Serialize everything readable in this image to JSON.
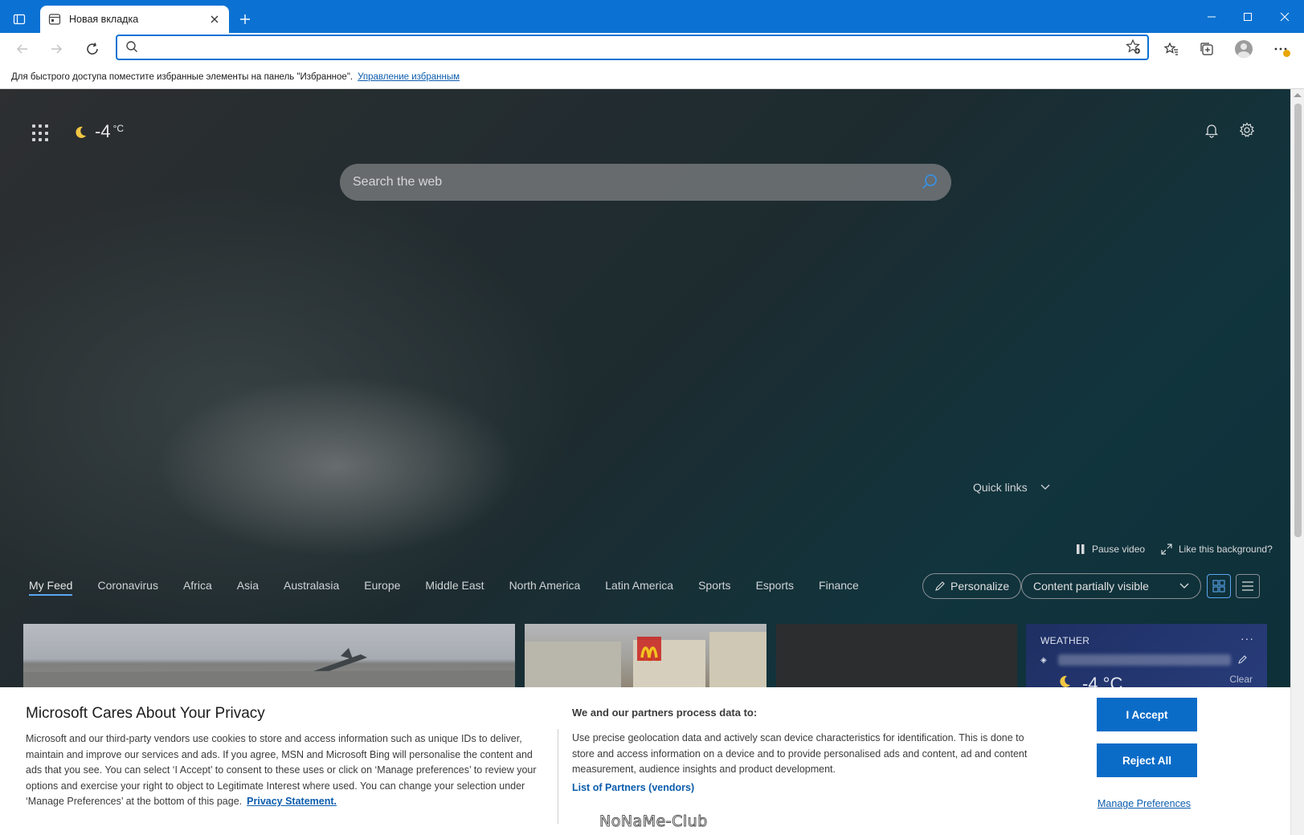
{
  "browser": {
    "tab": {
      "title": "Новая вкладка"
    },
    "address_bar": {
      "value": "",
      "placeholder": ""
    },
    "favorites_hint": {
      "text": "Для быстрого доступа поместите избранные элементы на панель \"Избранное\".",
      "link": "Управление избранным"
    }
  },
  "newtab": {
    "weather": {
      "temp": "-4",
      "unit": "°C"
    },
    "search": {
      "placeholder": "Search the web"
    },
    "quick_links": "Quick links",
    "pause_video": "Pause video",
    "like_background": "Like this background?",
    "feed_tabs": [
      {
        "label": "My Feed",
        "active": true
      },
      {
        "label": "Coronavirus"
      },
      {
        "label": "Africa"
      },
      {
        "label": "Asia"
      },
      {
        "label": "Australasia"
      },
      {
        "label": "Europe"
      },
      {
        "label": "Middle East"
      },
      {
        "label": "North America"
      },
      {
        "label": "Latin America"
      },
      {
        "label": "Sports"
      },
      {
        "label": "Esports"
      },
      {
        "label": "Finance"
      }
    ],
    "personalize": "Personalize",
    "content_visibility": "Content partially visible",
    "weather_card": {
      "heading": "WEATHER",
      "more": "···",
      "temp": "-4 °C",
      "condition": "Clear"
    }
  },
  "privacy": {
    "title": "Microsoft Cares About Your Privacy",
    "body": "Microsoft and our third-party vendors use cookies to store and access information such as unique IDs to deliver, maintain and improve our services and ads. If you agree, MSN and Microsoft Bing will personalise the content and ads that you see. You can select ‘I Accept’ to consent to these uses or click on ‘Manage preferences’ to review your options and exercise your right to object to Legitimate Interest where used. You can change your selection under ‘Manage Preferences’ at the bottom of this page.",
    "privacy_link": "Privacy Statement.",
    "process_heading": "We and our partners process data to:",
    "process_body": "Use precise geolocation data and actively scan device characteristics for identification. This is done to store and access information on a device and to provide personalised ads and content, ad and content measurement, audience insights and product development.",
    "partners_link": "List of Partners (vendors)",
    "accept": "I Accept",
    "reject": "Reject All",
    "manage": "Manage Preferences",
    "watermark": "NoNaMe-Club"
  }
}
